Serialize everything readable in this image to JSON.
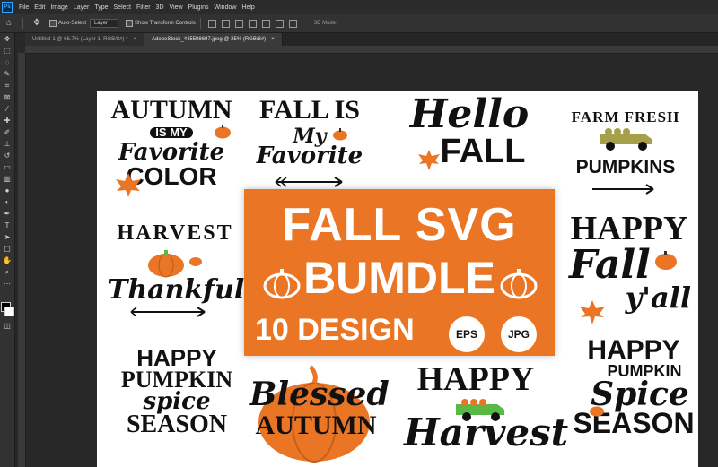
{
  "app": {
    "logo": "Ps"
  },
  "menu": [
    "File",
    "Edit",
    "Image",
    "Layer",
    "Type",
    "Select",
    "Filter",
    "3D",
    "View",
    "Plugins",
    "Window",
    "Help"
  ],
  "options": {
    "auto_select_label": "Auto-Select",
    "auto_select_target": "Layer",
    "show_transform_label": "Show Transform Controls",
    "mode_3d_label": "3D Mode:"
  },
  "tabs": [
    {
      "label": "Untitled-1 @ 66.7% (Layer 1, RGB/8#) *",
      "close": "×"
    },
    {
      "label": "AdobeStock_445598697.jpeg @ 25% (RGB/8#)",
      "close": "×"
    }
  ],
  "colors": {
    "accent": "#31a8ff",
    "orange": "#ea7625",
    "green": "#58b947",
    "olive": "#a7a04a"
  },
  "artwork": {
    "d1": {
      "l1": "AUTUMN",
      "l2": "IS MY",
      "l3": "Favorite",
      "l4": "COLOR"
    },
    "d2": {
      "l1": "FALL IS",
      "l2": "My",
      "l3": "Favorite"
    },
    "d3": {
      "l1": "Hello",
      "l2": "FALL"
    },
    "d4": {
      "l1": "FARM FRESH",
      "l2": "PUMPKINS"
    },
    "d5": {
      "l1": "HARVEST",
      "l2": "Thankful"
    },
    "banner": {
      "l1": "FALL SVG",
      "l2": "BUMDLE",
      "l3": "10 DESIGN",
      "b1": "EPS",
      "b2": "JPG"
    },
    "d6": {
      "l1": "HAPPY",
      "l2": "Fall",
      "l3": "y'all"
    },
    "d7": {
      "l1": "HAPPY",
      "l2": "PUMPKIN",
      "l3": "spice",
      "l4": "SEASON"
    },
    "d8": {
      "l1": "Blessed",
      "l2": "AUTUMN"
    },
    "d9": {
      "l1": "HAPPY",
      "l2": "Harvest"
    },
    "d10": {
      "l1": "HAPPY",
      "l2": "PUMPKIN",
      "l3": "Spice",
      "l4": "SEASON"
    }
  }
}
